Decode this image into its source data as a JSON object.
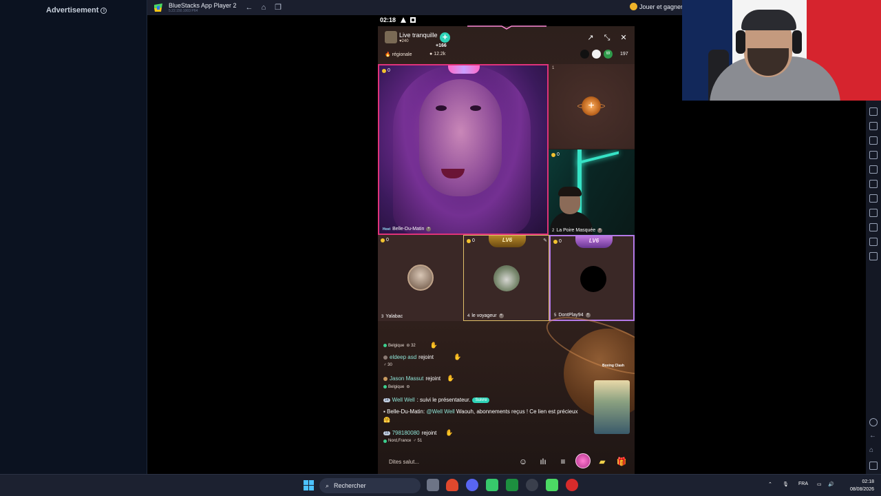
{
  "ad_panel": {
    "label": "Advertisement"
  },
  "bluestacks": {
    "title": "BlueStacks App Player 2",
    "version": "5.22.150.1003 P64",
    "play_earn": "Jouer et gagner"
  },
  "phone": {
    "status_time": "02:18",
    "room": {
      "title": "Live tranquille",
      "likes": "240",
      "followers": "+166",
      "region": "régionale",
      "coins": "12.2k",
      "viewer_count": "197",
      "viewer_badge": "W"
    },
    "seats": {
      "host": {
        "coins": "0",
        "tag": "Host",
        "name": "Belle-Du-Matin"
      },
      "seat1": {
        "number": "1"
      },
      "seat2": {
        "coins": "0",
        "number": "2",
        "name": "La Poire Masquée"
      },
      "seat3": {
        "coins": "0",
        "number": "3",
        "name": "Yalabac"
      },
      "seat4": {
        "coins": "0",
        "number": "4",
        "name": "le voyageur",
        "badge": "LV6"
      },
      "seat5": {
        "coins": "0",
        "number": "5",
        "name": "DontPlay94",
        "badge": "LV6"
      }
    },
    "chat": {
      "row1": {
        "location": "Belgique",
        "stat": "32"
      },
      "row2": {
        "name": "eldeep asd",
        "action": "rejoint"
      },
      "row3": {
        "stat": "30"
      },
      "row4": {
        "name": "Jason Massut",
        "action": "rejoint"
      },
      "row5": {
        "location": "Belgique"
      },
      "row6": {
        "level": "14",
        "name": "Well Well",
        "action": ": suivi le présentateur.",
        "button": "Suivre"
      },
      "host_msg": {
        "name": "Belle-Du-Matin:",
        "mention": "@Well Well",
        "text": "Waouh, abonnements reçus ! Ce lien est précieux"
      },
      "row8": {
        "level": "15",
        "name": "798180080",
        "action": "rejoint"
      },
      "row9": {
        "location": "Nord,France",
        "stat": "51"
      }
    },
    "boxing_clash": "Boxing Clash",
    "input_placeholder": "Dites salut..."
  },
  "taskbar": {
    "search": "Rechercher",
    "language": "FRA",
    "time": "02:18",
    "date": "08/08/2026"
  },
  "colors": {
    "accent_teal": "#2ed3b7",
    "host_border": "#e0337a",
    "gold_border": "#e3c16a",
    "purple_border": "#b47ae8"
  }
}
